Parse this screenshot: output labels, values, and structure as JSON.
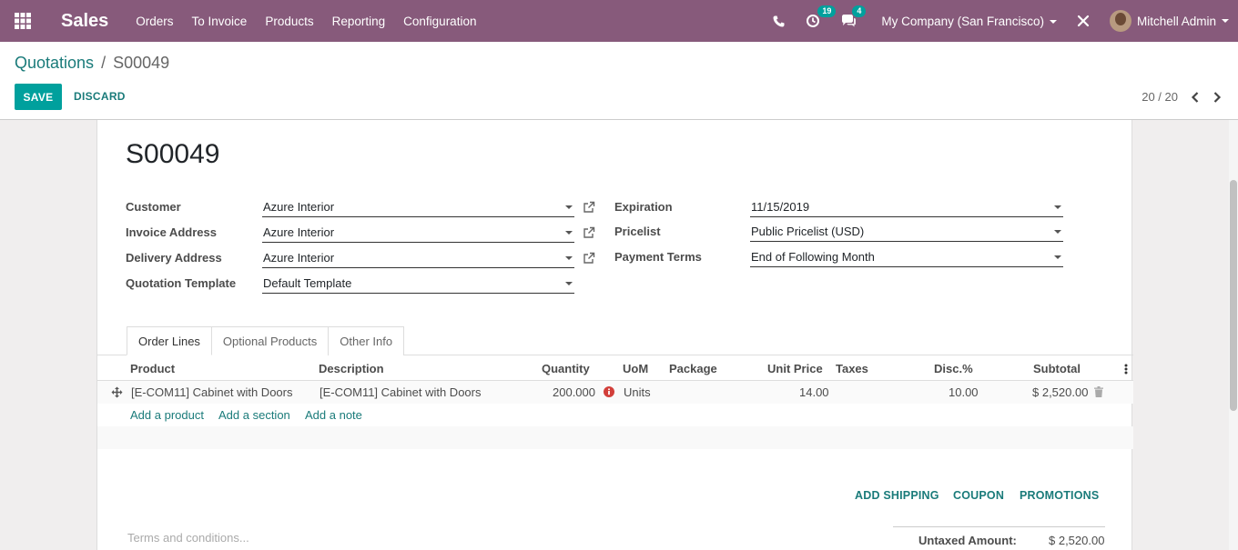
{
  "app": {
    "name": "Sales"
  },
  "menu": [
    "Orders",
    "To Invoice",
    "Products",
    "Reporting",
    "Configuration"
  ],
  "systray": {
    "activity_count": "19",
    "message_count": "4",
    "company": "My Company (San Francisco)",
    "user": "Mitchell Admin"
  },
  "breadcrumb": {
    "parent": "Quotations",
    "separator": "/",
    "current": "S00049"
  },
  "buttons": {
    "save": "SAVE",
    "discard": "DISCARD"
  },
  "pager": {
    "value": "20 / 20"
  },
  "form": {
    "title": "S00049",
    "left_fields": [
      {
        "label": "Customer",
        "value": "Azure Interior"
      },
      {
        "label": "Invoice Address",
        "value": "Azure Interior"
      },
      {
        "label": "Delivery Address",
        "value": "Azure Interior"
      },
      {
        "label": "Quotation Template",
        "value": "Default Template"
      }
    ],
    "right_fields": [
      {
        "label": "Expiration",
        "value": "11/15/2019"
      },
      {
        "label": "Pricelist",
        "value": "Public Pricelist (USD)"
      },
      {
        "label": "Payment Terms",
        "value": "End of Following Month"
      }
    ]
  },
  "tabs": [
    "Order Lines",
    "Optional Products",
    "Other Info"
  ],
  "table": {
    "headers": [
      "Product",
      "Description",
      "Quantity",
      "UoM",
      "Package",
      "Unit Price",
      "Taxes",
      "Disc.%",
      "Subtotal"
    ],
    "rows": [
      {
        "product": "[E-COM11] Cabinet with Doors",
        "description": "[E-COM11] Cabinet with Doors",
        "quantity": "200.000",
        "uom": "Units",
        "package": "",
        "unit_price": "14.00",
        "taxes": "",
        "discount": "10.00",
        "subtotal": "$ 2,520.00"
      }
    ],
    "add_links": [
      "Add a product",
      "Add a section",
      "Add a note"
    ]
  },
  "actions": [
    "ADD SHIPPING",
    "COUPON",
    "PROMOTIONS"
  ],
  "terms_placeholder": "Terms and conditions...",
  "totals": {
    "untaxed_label": "Untaxed Amount:",
    "untaxed_value": "$ 2,520.00"
  },
  "colors": {
    "brand": "#875a7b",
    "accent": "#00a09d",
    "link": "#1a7b7a"
  }
}
